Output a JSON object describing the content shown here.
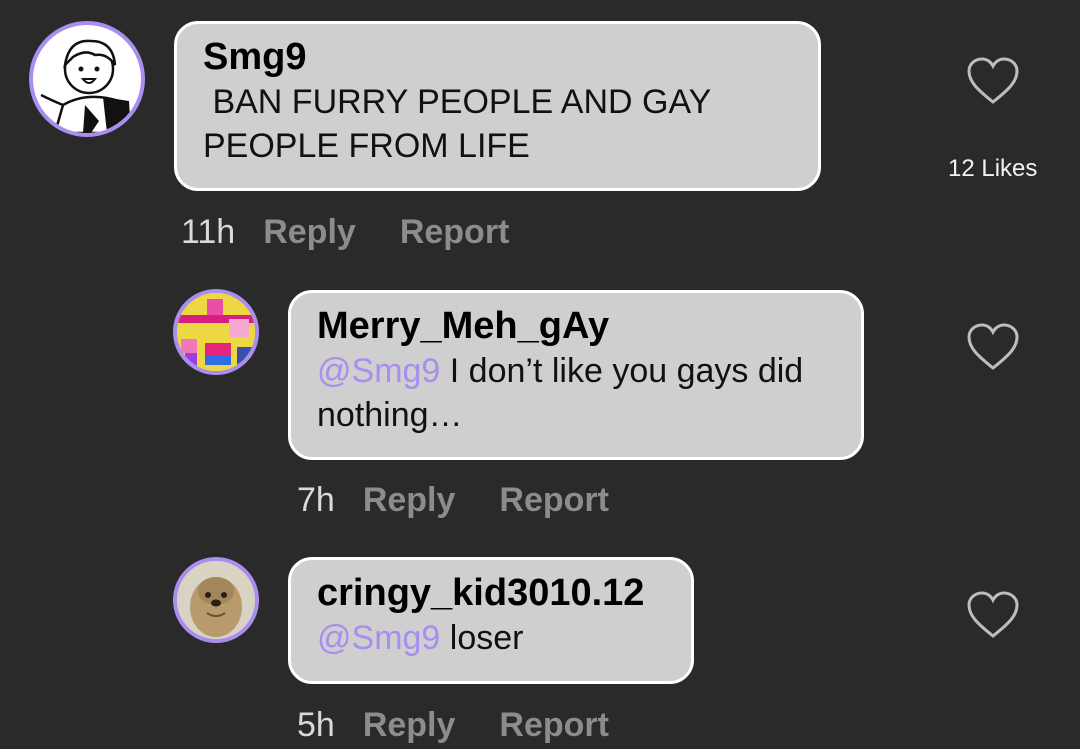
{
  "comments": [
    {
      "author": "Smg9",
      "text": " BAN FURRY PEOPLE AND GAY\nPEOPLE FROM LIFE",
      "time": "11h",
      "reply": "Reply",
      "report": "Report",
      "likes": "12 Likes"
    },
    {
      "author": "Merry_Meh_gAy",
      "mention": "@Smg9",
      "text": " I don’t like you gays did\nnothing…",
      "time": "7h",
      "reply": "Reply",
      "report": "Report"
    },
    {
      "author": "cringy_kid3010.12",
      "mention": "@Smg9",
      "text": " loser",
      "time": "5h",
      "reply": "Reply",
      "report": "Report"
    }
  ],
  "colors": {
    "background": "#2a2a2b",
    "bubble": "#cfcfcf",
    "accent": "#a98ef0",
    "muted": "#8c8c8c"
  },
  "icons": {
    "like": "heart-outline-icon"
  }
}
